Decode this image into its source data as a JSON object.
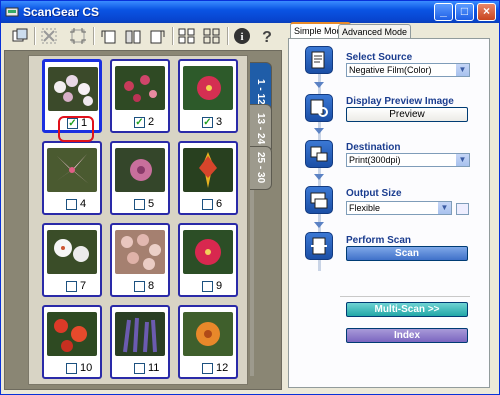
{
  "window": {
    "title": "ScanGear CS"
  },
  "titlebar_buttons": [
    "_",
    "□",
    "×"
  ],
  "toolbar": {
    "icons": [
      "preview-all-icon",
      "clear-icon",
      "crop-icon",
      "rotate-left-icon",
      "mirror-icon",
      "rotate-right-icon",
      "select-all-icon",
      "thumbnail-icon",
      "info-icon",
      "help-icon"
    ]
  },
  "side_tabs": [
    "1 - 12",
    "13 - 24",
    "25 - 30"
  ],
  "frames": [
    {
      "num": "1",
      "checked": true
    },
    {
      "num": "2",
      "checked": true
    },
    {
      "num": "3",
      "checked": true
    },
    {
      "num": "4",
      "checked": false
    },
    {
      "num": "5",
      "checked": false
    },
    {
      "num": "6",
      "checked": false
    },
    {
      "num": "7",
      "checked": false
    },
    {
      "num": "8",
      "checked": false
    },
    {
      "num": "9",
      "checked": false
    },
    {
      "num": "10",
      "checked": false
    },
    {
      "num": "11",
      "checked": false
    },
    {
      "num": "12",
      "checked": false
    }
  ],
  "tabs": {
    "simple": "Simple Mode",
    "advanced": "Advanced Mode"
  },
  "steps": {
    "source": {
      "label": "Select Source",
      "value": "Negative Film(Color)"
    },
    "preview": {
      "label": "Display Preview Image",
      "button": "Preview"
    },
    "destination": {
      "label": "Destination",
      "value": "Print(300dpi)"
    },
    "output": {
      "label": "Output Size",
      "value": "Flexible"
    },
    "scan": {
      "label": "Perform Scan",
      "button": "Scan"
    }
  },
  "buttons": {
    "multi_scan": "Multi-Scan >>",
    "index": "Index"
  },
  "colors": {
    "titlebar": "#0a54e3",
    "accent": "#1b3d8f",
    "highlight": "#e0111b"
  }
}
